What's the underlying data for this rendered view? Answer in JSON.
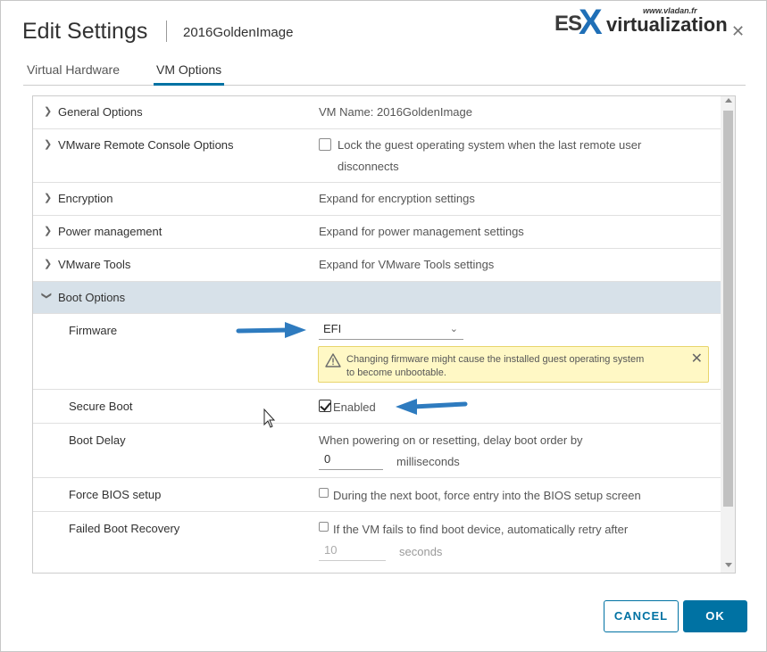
{
  "header": {
    "title": "Edit Settings",
    "vm_name": "2016GoldenImage",
    "close": "✕"
  },
  "watermark": {
    "es": "ES",
    "x": "X",
    "virtualization": "virtualization",
    "url": "www.vladan.fr"
  },
  "tabs": [
    {
      "label": "Virtual Hardware",
      "active": false
    },
    {
      "label": "VM Options",
      "active": true
    }
  ],
  "sections": {
    "general": {
      "label": "General Options",
      "value": "VM Name: 2016GoldenImage"
    },
    "vmrc": {
      "label": "VMware Remote Console Options",
      "checkbox_label": "Lock the guest operating system when the last remote user",
      "checkbox_label_2": "disconnects",
      "checked": false
    },
    "encryption": {
      "label": "Encryption",
      "value": "Expand for encryption settings"
    },
    "power": {
      "label": "Power management",
      "value": "Expand for power management settings"
    },
    "tools": {
      "label": "VMware Tools",
      "value": "Expand for VMware Tools settings"
    },
    "boot": {
      "label": "Boot Options",
      "expanded": true
    }
  },
  "boot_options": {
    "firmware": {
      "label": "Firmware",
      "selected": "EFI",
      "warning_line1": "Changing firmware might cause the installed guest operating system",
      "warning_line2": "to become unbootable."
    },
    "secure_boot": {
      "label": "Secure Boot",
      "checkbox_label": "Enabled",
      "checked": true
    },
    "boot_delay": {
      "label": "Boot Delay",
      "description": "When powering on or resetting, delay boot order by",
      "value": "0",
      "unit": "milliseconds"
    },
    "force_bios": {
      "label": "Force BIOS setup",
      "checkbox_label": "During the next boot, force entry into the BIOS setup screen",
      "checked": false
    },
    "failed_recovery": {
      "label": "Failed Boot Recovery",
      "checkbox_label": "If the VM fails to find boot device, automatically retry after",
      "checked": false,
      "value": "10",
      "unit": "seconds"
    }
  },
  "footer": {
    "cancel": "CANCEL",
    "ok": "OK"
  },
  "colors": {
    "accent": "#0072a3",
    "selected_row": "#d7e1e9",
    "warning_bg": "#fff8c5",
    "annotation_arrow": "#2e7bbf"
  },
  "icons": {
    "expand": "chevron-right-icon",
    "collapse": "chevron-down-icon",
    "warning": "warning-triangle-icon",
    "close": "close-icon"
  }
}
